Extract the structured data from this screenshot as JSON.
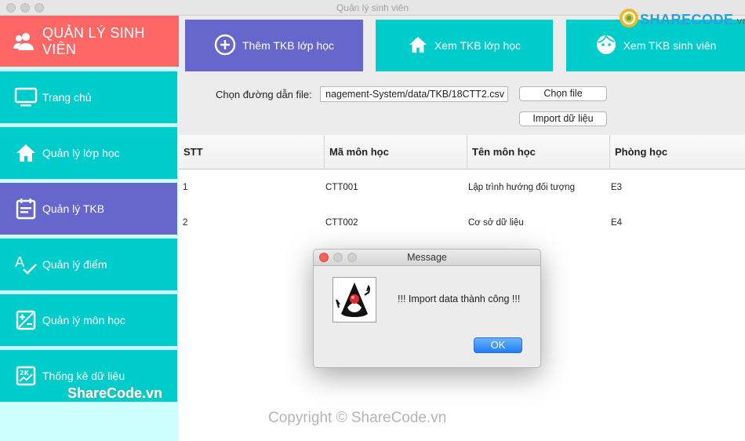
{
  "window": {
    "title": "Quản lý sinh viên"
  },
  "watermark": {
    "logo": "SHARECODE",
    "logo_tld": ".vn",
    "side": "ShareCode.vn",
    "bottom": "Copyright © ShareCode.vn"
  },
  "sidebar": {
    "header": {
      "label": "QUẢN LÝ SINH VIÊN",
      "icon": "users-icon"
    },
    "items": [
      {
        "label": "Trang chủ",
        "icon": "monitor-icon",
        "active": false
      },
      {
        "label": "Quản lý lớp học",
        "icon": "home-icon",
        "active": false
      },
      {
        "label": "Quản lý TKB",
        "icon": "calendar-icon",
        "active": true
      },
      {
        "label": "Quản lý điểm",
        "icon": "spellcheck-icon",
        "active": false
      },
      {
        "label": "Quản lý môn học",
        "icon": "plus-minus-box-icon",
        "active": false
      },
      {
        "label": "Thống kê dữ liệu",
        "icon": "chart-icon",
        "active": false
      }
    ]
  },
  "toolbar": {
    "buttons": [
      {
        "label": "Thêm TKB lớp học",
        "icon": "add-circle-icon",
        "color": "#6666cc"
      },
      {
        "label": "Xem TKB lớp học",
        "icon": "home-icon",
        "color": "#00cccc"
      },
      {
        "label": "Xem TKB sinh viên",
        "icon": "face-icon",
        "color": "#00cccc"
      }
    ]
  },
  "file": {
    "label": "Chọn đường dẫn file:",
    "path": "nagement-System/data/TKB/18CTT2.csv",
    "choose_button": "Chọn file",
    "import_button": "Import dữ liệu"
  },
  "table": {
    "headers": [
      "STT",
      "Mã môn học",
      "Tên môn học",
      "Phòng học"
    ],
    "rows": [
      [
        "1",
        "CTT001",
        "Lập trình hướng đối tượng",
        "E3"
      ],
      [
        "2",
        "CTT002",
        "Cơ sở dữ liệu",
        "E4"
      ]
    ]
  },
  "dialog": {
    "title": "Message",
    "message": "!!! Import data thành công !!!",
    "ok_label": "OK"
  },
  "colors": {
    "sidebar_header": "#ff6666",
    "sidebar_item": "#00cccc",
    "sidebar_active": "#6666cc",
    "sidebar_bg": "#ccffff"
  }
}
